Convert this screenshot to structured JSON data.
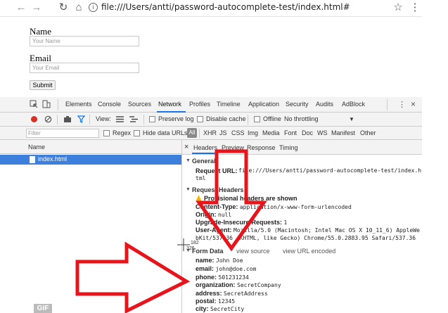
{
  "browser": {
    "url": "file:///Users/antti/password-autocomplete-test/index.html#",
    "back_glyph": "←",
    "forward_glyph": "→",
    "reload_glyph": "↻",
    "home_glyph": "⌂",
    "info_glyph": "i",
    "star_glyph": "☆",
    "menu_glyph": "⋮"
  },
  "form": {
    "name_label": "Name",
    "name_placeholder": "Your Name",
    "email_label": "Email",
    "email_placeholder": "Your Email",
    "submit_label": "Submit"
  },
  "devtools": {
    "tabs": [
      "Elements",
      "Console",
      "Sources",
      "Network",
      "Profiles",
      "Timeline",
      "Application",
      "Security",
      "Audits",
      "AdBlock"
    ],
    "active_tab": "Network",
    "toolbar": {
      "view_label": "View:",
      "preserve_log": "Preserve log",
      "disable_cache": "Disable cache",
      "offline": "Offline",
      "throttling": "No throttling"
    },
    "filter": {
      "placeholder": "Filter",
      "regex": "Regex",
      "hide_data_urls": "Hide data URLs",
      "all": "All",
      "types": [
        "XHR",
        "JS",
        "CSS",
        "Img",
        "Media",
        "Font",
        "Doc",
        "WS",
        "Manifest",
        "Other"
      ]
    },
    "request_list": {
      "name_column": "Name",
      "requests": [
        "index.html"
      ]
    },
    "detail": {
      "close_glyph": "×",
      "tabs": [
        "Headers",
        "Preview",
        "Response",
        "Timing"
      ],
      "general_title": "General",
      "request_url_key": "Request URL:",
      "request_url_value_1": "file:///Users/antti/password-autocomplete-test/index.h",
      "request_url_value_2": "tml",
      "request_headers_title": "Request Headers",
      "provisional_warning": "Provisional headers are shown",
      "headers": [
        {
          "key": "Content-Type:",
          "value": "application/x-www-form-urlencoded"
        },
        {
          "key": "Origin:",
          "value": "null"
        },
        {
          "key": "Upgrade-Insecure-Requests:",
          "value": "1"
        },
        {
          "key": "User-Agent:",
          "value": "Mozilla/5.0 (Macintosh; Intel Mac OS X 10_11_6) AppleWe"
        }
      ],
      "user_agent_cont": "bKit/537.36 (KHTML, like Gecko) Chrome/55.0.2883.95 Safari/537.36",
      "form_data_title": "Form Data",
      "view_source": "view source",
      "view_url_encoded": "view URL encoded",
      "form_data": [
        {
          "key": "name:",
          "value": "John Doe"
        },
        {
          "key": "email:",
          "value": "john@doe.com"
        },
        {
          "key": "phone:",
          "value": "501231234"
        },
        {
          "key": "organization:",
          "value": "SecretCompany"
        },
        {
          "key": "address:",
          "value": "SecretAddress"
        },
        {
          "key": "postal:",
          "value": "12345"
        },
        {
          "key": "city:",
          "value": "SecretCity"
        }
      ]
    }
  },
  "cursor_readout": {
    "x": "182",
    "y": "326"
  },
  "gif_badge": "GIF",
  "colors": {
    "arrow": "#e8141b",
    "selection": "#3d7fdc",
    "record": "#d93025",
    "tab_accent": "#1a73e8"
  }
}
